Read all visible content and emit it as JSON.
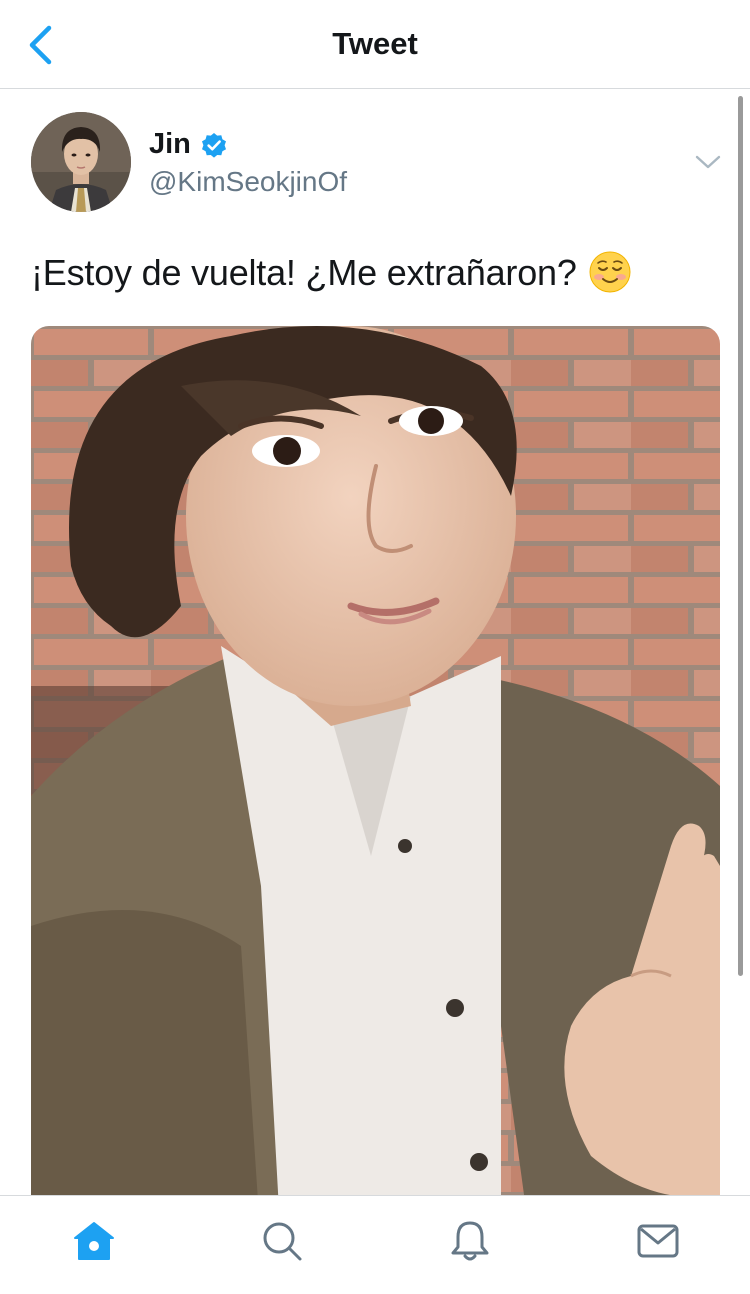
{
  "header": {
    "title": "Tweet",
    "back_icon": "chevron-left-icon"
  },
  "tweet": {
    "author": {
      "name": "Jin",
      "handle": "@KimSeokjinOf",
      "verified": true
    },
    "text": "¡Estoy de vuelta! ¿Me extrañaron?",
    "emoji": "☺️",
    "menu_icon": "chevron-down-icon"
  },
  "tab_bar": [
    {
      "name": "home",
      "icon": "home-icon",
      "active": true
    },
    {
      "name": "search",
      "icon": "search-icon",
      "active": false
    },
    {
      "name": "notifications",
      "icon": "bell-icon",
      "active": false
    },
    {
      "name": "messages",
      "icon": "mail-icon",
      "active": false
    }
  ],
  "colors": {
    "accent": "#1da1f2",
    "text": "#14171a",
    "secondary_text": "#657786",
    "divider": "#d7dadd"
  }
}
